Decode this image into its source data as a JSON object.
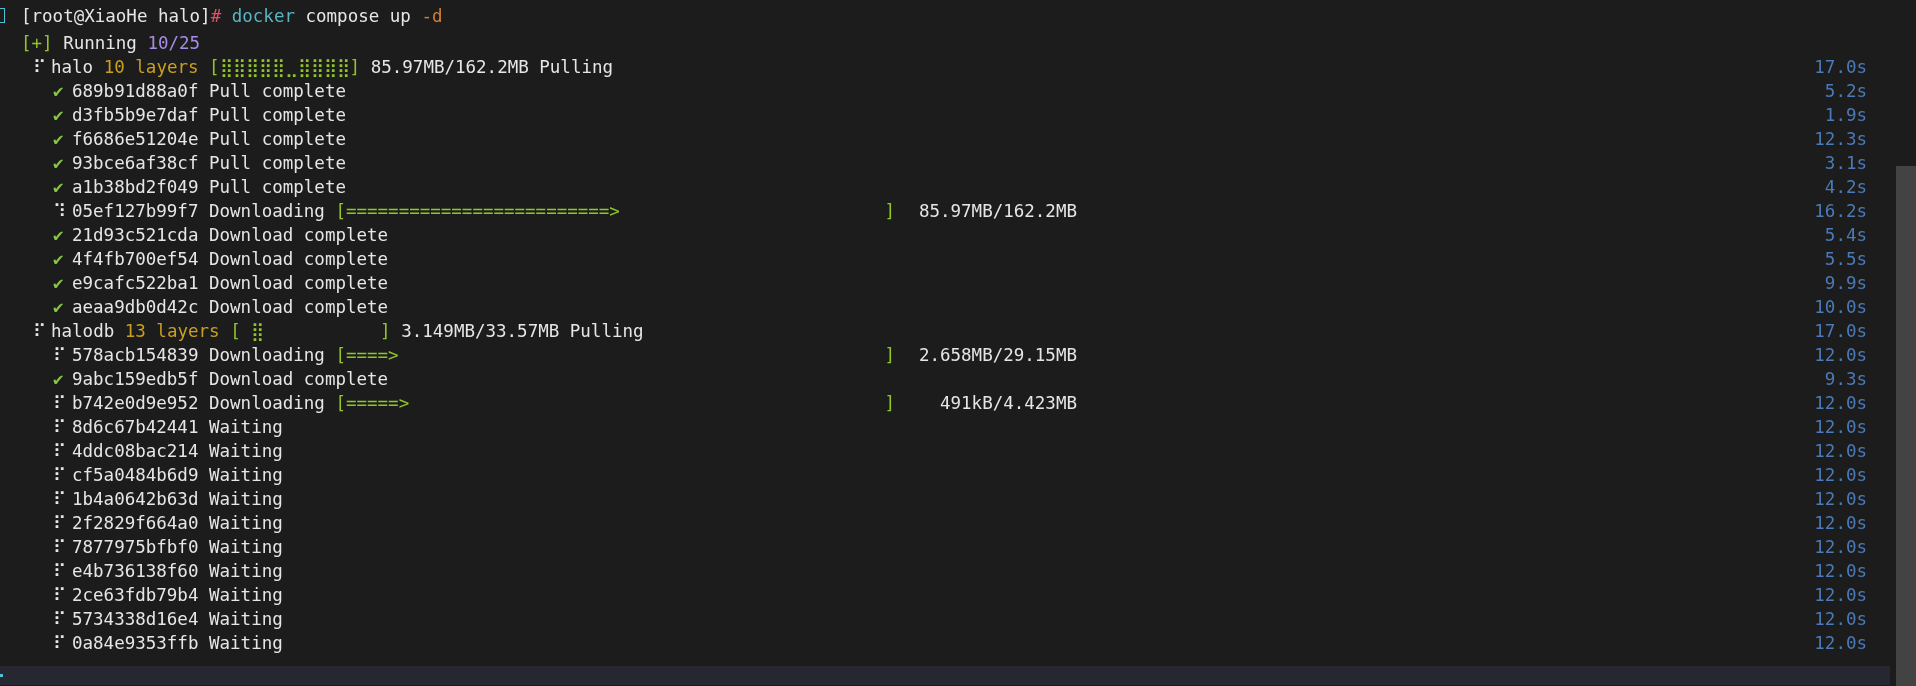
{
  "prompt": {
    "user_host": "[root@XiaoHe halo]",
    "symbol": "#",
    "command": "docker",
    "args": "compose up",
    "flag": "-d"
  },
  "status": {
    "bracket": "[+]",
    "label": "Running",
    "count": "10/25"
  },
  "services": [
    {
      "icon": "⠏",
      "name": "halo",
      "layers": "10 layers",
      "bar": "[⣿⣿⣿⣿⣿⣀⣿⣿⣿⣿]",
      "size": "85.97MB/162.2MB",
      "state": "Pulling",
      "time": "17.0s",
      "children": [
        {
          "kind": "done",
          "icon": "✔",
          "id": "689b91d88a0f",
          "text": "Pull complete",
          "time": "5.2s"
        },
        {
          "kind": "done",
          "icon": "✔",
          "id": "d3fb5b9e7daf",
          "text": "Pull complete",
          "time": "1.9s"
        },
        {
          "kind": "done",
          "icon": "✔",
          "id": "f6686e51204e",
          "text": "Pull complete",
          "time": "12.3s"
        },
        {
          "kind": "done",
          "icon": "✔",
          "id": "93bce6af38cf",
          "text": "Pull complete",
          "time": "3.1s"
        },
        {
          "kind": "done",
          "icon": "✔",
          "id": "a1b38bd2f049",
          "text": "Pull complete",
          "time": "4.2s"
        },
        {
          "kind": "active",
          "icon": "⠹",
          "id": "05ef127b99f7",
          "text": "Downloading",
          "bar": "[=========================>",
          "bar_end": "]",
          "size": "85.97MB/162.2MB",
          "time": "16.2s"
        },
        {
          "kind": "done",
          "icon": "✔",
          "id": "21d93c521cda",
          "text": "Download complete",
          "time": "5.4s"
        },
        {
          "kind": "done",
          "icon": "✔",
          "id": "4f4fb700ef54",
          "text": "Download complete",
          "time": "5.5s"
        },
        {
          "kind": "done",
          "icon": "✔",
          "id": "e9cafc522ba1",
          "text": "Download complete",
          "time": "9.9s"
        },
        {
          "kind": "done",
          "icon": "✔",
          "id": "aeaa9db0d42c",
          "text": "Download complete",
          "time": "10.0s"
        }
      ]
    },
    {
      "icon": "⠏",
      "name": "halodb",
      "layers": "13 layers",
      "bar": "[ ⣿           ]",
      "size": "3.149MB/33.57MB",
      "state": "Pulling",
      "time": "17.0s",
      "children": [
        {
          "kind": "active",
          "icon": "⠏",
          "id": "578acb154839",
          "text": "Downloading",
          "bar": "[====>",
          "bar_end": "]",
          "size": "2.658MB/29.15MB",
          "time": "12.0s"
        },
        {
          "kind": "done",
          "icon": "✔",
          "id": "9abc159edb5f",
          "text": "Download complete",
          "time": "9.3s"
        },
        {
          "kind": "active",
          "icon": "⠏",
          "id": "b742e0d9e952",
          "text": "Downloading",
          "bar": "[=====>",
          "bar_end": "]",
          "size": "491kB/4.423MB",
          "time": "12.0s"
        },
        {
          "kind": "active",
          "icon": "⠏",
          "id": "8d6c67b42441",
          "text": "Waiting",
          "time": "12.0s"
        },
        {
          "kind": "active",
          "icon": "⠏",
          "id": "4ddc08bac214",
          "text": "Waiting",
          "time": "12.0s"
        },
        {
          "kind": "active",
          "icon": "⠏",
          "id": "cf5a0484b6d9",
          "text": "Waiting",
          "time": "12.0s"
        },
        {
          "kind": "active",
          "icon": "⠏",
          "id": "1b4a0642b63d",
          "text": "Waiting",
          "time": "12.0s"
        },
        {
          "kind": "active",
          "icon": "⠏",
          "id": "2f2829f664a0",
          "text": "Waiting",
          "time": "12.0s"
        },
        {
          "kind": "active",
          "icon": "⠏",
          "id": "7877975bfbf0",
          "text": "Waiting",
          "time": "12.0s"
        },
        {
          "kind": "active",
          "icon": "⠏",
          "id": "e4b736138f60",
          "text": "Waiting",
          "time": "12.0s"
        },
        {
          "kind": "active",
          "icon": "⠏",
          "id": "2ce63fdb79b4",
          "text": "Waiting",
          "time": "12.0s"
        },
        {
          "kind": "active",
          "icon": "⠏",
          "id": "5734338d16e4",
          "text": "Waiting",
          "time": "12.0s"
        },
        {
          "kind": "active",
          "icon": "⠏",
          "id": "0a84e9353ffb",
          "text": "Waiting",
          "time": "12.0s"
        }
      ]
    }
  ]
}
